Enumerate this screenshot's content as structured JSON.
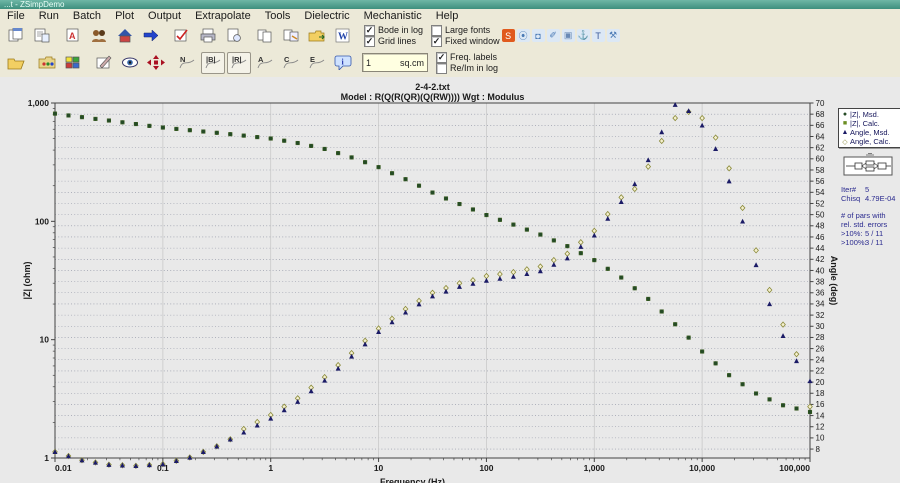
{
  "window": {
    "title": "...t - ZSimpDemo"
  },
  "menu": [
    "File",
    "Run",
    "Batch",
    "Plot",
    "Output",
    "Extrapolate",
    "Tools",
    "Dielectric",
    "Mechanistic",
    "Help"
  ],
  "toolbar1_icons": [
    "sheets-icon",
    "sheets2-icon",
    "textfile-icon",
    "people-icon",
    "home-icon",
    "arrow-right-icon",
    "edit-check-icon",
    "print-icon",
    "print-preview-icon",
    "copy-pages-icon",
    "copy-export-icon",
    "folder-export-icon",
    "word-icon"
  ],
  "toolbar2_icons": [
    "open-folder-icon",
    "folder-palette-icon",
    "tiles-icon",
    "sign-icon",
    "eye-icon",
    "move-icon"
  ],
  "plot_buttons": [
    {
      "label": "N",
      "active": false
    },
    {
      "label": "|B|",
      "active": true
    },
    {
      "label": "|R|",
      "active": true
    },
    {
      "label": "A",
      "active": false
    },
    {
      "label": "C",
      "active": false
    },
    {
      "label": "E",
      "active": false
    }
  ],
  "info_button": {
    "label": "i"
  },
  "checkboxes": {
    "row1col1": [
      {
        "label": "Bode in log",
        "checked": true
      },
      {
        "label": "Grid lines",
        "checked": true
      }
    ],
    "row1col2": [
      {
        "label": "Large fonts",
        "checked": false
      },
      {
        "label": "Fixed window",
        "checked": true
      }
    ],
    "row2": [
      {
        "label": "Freq. labels",
        "checked": true
      },
      {
        "label": "Re/Im in log",
        "checked": false
      }
    ]
  },
  "unit_field": {
    "value": "1",
    "unit": "sq.cm"
  },
  "plugin_icons": [
    "s-logo",
    "pin-icon",
    "moon-icon",
    "pen-icon",
    "screen-icon",
    "anchor-icon",
    "shirt-icon",
    "wrench-icon"
  ],
  "legend": [
    {
      "marker": "dot",
      "color": "#254b25",
      "label": "|Z|,  Msd."
    },
    {
      "marker": "square",
      "color": "#6b8e23",
      "label": "|Z|,  Calc."
    },
    {
      "marker": "triangle",
      "color": "#1b1b66",
      "label": "Angle,  Msd."
    },
    {
      "marker": "diamond",
      "color": "#8a8a3a",
      "label": "Angle,  Calc."
    }
  ],
  "stats": {
    "rows1": [
      [
        "Iter#",
        "5"
      ],
      [
        "Chisq",
        "4.79E-04"
      ]
    ],
    "note": [
      "# of pars with",
      "rel. std. errors"
    ],
    "rows2": [
      [
        ">10%:",
        "5 / 11"
      ],
      [
        ">100%:",
        "3 / 11"
      ]
    ]
  },
  "chart_data": {
    "type": "scatter",
    "title": "2-4-2.txt",
    "subtitle": "Model : R(Q(R(QR)(Q(RW))))     Wgt : Modulus",
    "xlabel": "Frequency  (Hz)",
    "ylabel_left": "|Z|  (ohm)",
    "ylabel_right": "Angle  (deg)",
    "x_axis": {
      "scale": "log",
      "min": 0.01,
      "max": 100000,
      "tick_labels": [
        "0.01",
        "0.1",
        "1",
        "10",
        "100",
        "1,000",
        "10,000",
        "100,000"
      ]
    },
    "y_left_axis": {
      "scale": "log",
      "min": 1,
      "max": 1000,
      "tick_labels": [
        "1,000",
        "100",
        "10",
        "1"
      ]
    },
    "y_right_axis": {
      "min": 6.4,
      "max": 70,
      "tick_max": 70,
      "tick_min": 8,
      "tick_step": 2
    },
    "grid": true,
    "legend_position": "outside-right",
    "log_f_start": -2,
    "log_f_step": 0.125,
    "n_points": 57,
    "series": [
      {
        "name": "|Z|, Msd.",
        "axis": "left",
        "marker": "dot",
        "color": "#254b25",
        "values": [
          813,
          785,
          759,
          734,
          711,
          687,
          664,
          641,
          620,
          604,
          589,
          574,
          560,
          545,
          530,
          515,
          501,
          480,
          459,
          434,
          409,
          377,
          347,
          316,
          287,
          255,
          227,
          200,
          175,
          156,
          140,
          126,
          113,
          103,
          93.8,
          85.1,
          77.3,
          69.0,
          61.7,
          53.8,
          47.0,
          39.7,
          33.5,
          27.2,
          22.1,
          17.3,
          13.5,
          10.4,
          7.94,
          6.31,
          5.01,
          4.2,
          3.51,
          3.13,
          2.79,
          2.62,
          2.45
        ]
      },
      {
        "name": "|Z|, Calc.",
        "axis": "left",
        "marker": "square",
        "color": "#9fbf5f",
        "values": [
          813,
          785,
          759,
          734,
          711,
          687,
          664,
          641,
          620,
          604,
          589,
          574,
          560,
          545,
          530,
          515,
          501,
          480,
          459,
          434,
          409,
          377,
          347,
          316,
          287,
          255,
          227,
          200,
          175,
          156,
          140,
          126,
          113,
          103,
          93.8,
          85.1,
          77.3,
          69.0,
          61.7,
          53.8,
          47.0,
          39.7,
          33.5,
          27.2,
          22.1,
          17.3,
          13.5,
          10.4,
          7.94,
          6.31,
          5.01,
          4.2,
          3.51,
          3.13,
          2.79,
          2.62,
          2.45
        ]
      },
      {
        "name": "Angle, Msd.",
        "axis": "right",
        "marker": "triangle",
        "color": "#1b1b66",
        "values": [
          7.5,
          6.75,
          6.0,
          5.6,
          5.2,
          5.1,
          5.0,
          5.15,
          5.3,
          5.9,
          6.5,
          7.5,
          8.5,
          9.75,
          11.0,
          12.25,
          13.5,
          15.0,
          16.5,
          18.4,
          20.3,
          22.45,
          24.6,
          26.8,
          29.0,
          30.75,
          32.5,
          33.95,
          35.4,
          36.25,
          37.1,
          37.65,
          38.2,
          38.55,
          38.9,
          39.4,
          39.9,
          41.05,
          42.2,
          44.25,
          46.3,
          49.3,
          52.3,
          55.5,
          59.8,
          64.8,
          69.7,
          68.6,
          66.0,
          61.8,
          56.0,
          48.8,
          41.0,
          34.0,
          28.3,
          23.8,
          20.2
        ]
      },
      {
        "name": "Angle, Calc.",
        "axis": "right",
        "marker": "diamond",
        "color": "#8a8a3a",
        "values": [
          7.5,
          6.75,
          6.0,
          5.6,
          5.2,
          5.1,
          5.0,
          5.15,
          5.3,
          5.9,
          6.5,
          7.5,
          8.5,
          9.75,
          11.6,
          12.85,
          14.1,
          15.6,
          17.1,
          19.0,
          20.9,
          23.05,
          25.2,
          27.4,
          29.6,
          31.35,
          33.1,
          34.55,
          36.0,
          36.85,
          37.7,
          38.25,
          39.0,
          39.35,
          39.7,
          40.2,
          40.7,
          41.85,
          43.0,
          45.05,
          47.1,
          50.1,
          53.1,
          54.6,
          58.6,
          63.2,
          67.3,
          68.4,
          67.3,
          63.8,
          58.3,
          51.2,
          43.6,
          36.5,
          30.3,
          25.0,
          15.6
        ]
      }
    ]
  }
}
